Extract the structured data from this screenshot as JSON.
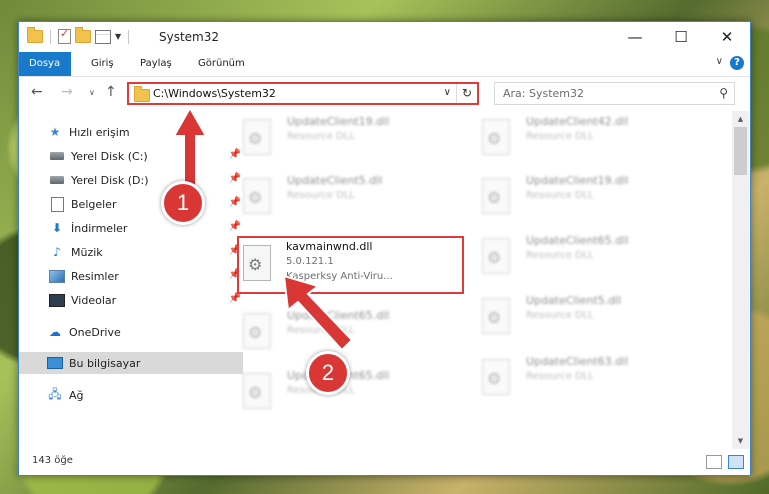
{
  "window": {
    "title": "System32",
    "controls": {
      "minimize": "—",
      "maximize": "☐",
      "close": "✕"
    }
  },
  "ribbon": {
    "tabs": [
      "Dosya",
      "Giriş",
      "Paylaş",
      "Görünüm"
    ],
    "help": "?"
  },
  "address": {
    "path": "C:\\Windows\\System32",
    "search_placeholder": "Ara: System32"
  },
  "sidebar": {
    "items": [
      {
        "label": "Hızlı erişim",
        "icon": "star-icon"
      },
      {
        "label": "Yerel Disk (C:)",
        "icon": "disk-icon",
        "pinned": true
      },
      {
        "label": "Yerel Disk (D:)",
        "icon": "disk-icon",
        "pinned": true
      },
      {
        "label": "Belgeler",
        "icon": "documents-icon",
        "pinned": true
      },
      {
        "label": "İndirmeler",
        "icon": "download-icon",
        "pinned": true
      },
      {
        "label": "Müzik",
        "icon": "music-icon",
        "pinned": true
      },
      {
        "label": "Resimler",
        "icon": "pictures-icon",
        "pinned": true
      },
      {
        "label": "Videolar",
        "icon": "videos-icon",
        "pinned": true
      },
      {
        "label": "OneDrive",
        "icon": "cloud-icon"
      },
      {
        "label": "Bu bilgisayar",
        "icon": "computer-icon",
        "selected": true
      },
      {
        "label": "Ağ",
        "icon": "network-icon"
      }
    ]
  },
  "files": {
    "col1": [
      {
        "name": "UpdateClient19.dll",
        "sub": "Resource DLL"
      },
      {
        "name": "UpdateClient5.dll",
        "sub": "Resource DLL"
      },
      {
        "name": "UpdateClient65.dll",
        "sub": "Resource DLL"
      },
      {
        "name": "UpdateClient65.dll",
        "sub": "Resource DLL"
      }
    ],
    "col2": [
      {
        "name": "UpdateClient42.dll",
        "sub": "Resource DLL"
      },
      {
        "name": "UpdateClient19.dll",
        "sub": "Resource DLL"
      },
      {
        "name": "UpdateClient65.dll",
        "sub": "Resource DLL"
      },
      {
        "name": "UpdateClient5.dll",
        "sub": "Resource DLL"
      },
      {
        "name": "UpdateClient63.dll",
        "sub": "Resource DLL"
      }
    ],
    "selected": {
      "name": "kavmainwnd.dll",
      "version": "5.0.121.1",
      "company": "Kasperksy Anti-Viru..."
    }
  },
  "status": {
    "count": "143 öğe"
  },
  "annotations": {
    "step1": "1",
    "step2": "2"
  },
  "colors": {
    "highlight": "#e03a3a",
    "accent": "#1979ca"
  }
}
